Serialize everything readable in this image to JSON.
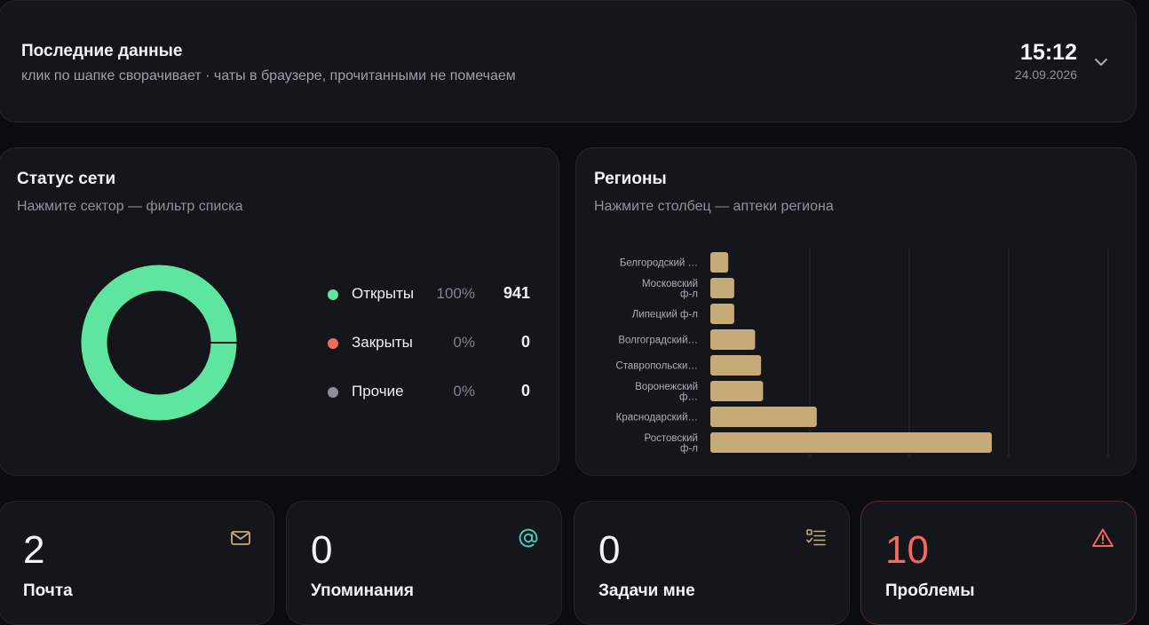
{
  "header": {
    "title": "Последние данные",
    "subtitle": "клик по шапке сворачивает · чаты в браузере, прочитанными не помечаем",
    "time": "15:12",
    "date": "24.09.2026"
  },
  "status": {
    "title": "Статус сети",
    "subtitle": "Нажмите сектор — фильтр списка",
    "items": [
      {
        "label": "Открыты",
        "percent": "100%",
        "count": "941",
        "color": "#5ee6a0"
      },
      {
        "label": "Закрыты",
        "percent": "0%",
        "count": "0",
        "color": "#f26a5b"
      },
      {
        "label": "Прочие",
        "percent": "0%",
        "count": "0",
        "color": "#8b8f99"
      }
    ]
  },
  "regions": {
    "title": "Регионы",
    "subtitle": "Нажмите столбец — аптеки региона"
  },
  "chart_data": {
    "type": "bar",
    "orientation": "horizontal",
    "categories": [
      [
        "Белгородский …"
      ],
      [
        "Московский",
        "ф-л"
      ],
      [
        "Липецкий ф-л"
      ],
      [
        "Волгоградский…"
      ],
      [
        "Ставропольски…"
      ],
      [
        "Воронежский",
        "ф…"
      ],
      [
        "Краснодарский…"
      ],
      [
        "Ростовский",
        "ф-л"
      ]
    ],
    "values": [
      18,
      24,
      24,
      45,
      51,
      53,
      107,
      283
    ],
    "xlim": [
      0,
      400
    ],
    "grid": true,
    "bar_color": "#c6ab78"
  },
  "stats": [
    {
      "value": "2",
      "label": "Почта",
      "icon": "mail-icon",
      "color": "#c6ab78"
    },
    {
      "value": "0",
      "label": "Упоминания",
      "icon": "at-icon",
      "color": "#4cc3b8"
    },
    {
      "value": "0",
      "label": "Задачи мне",
      "icon": "checklist-icon",
      "color": "#c6ab78"
    },
    {
      "value": "10",
      "label": "Проблемы",
      "icon": "warning-icon",
      "color": "#f26a5b"
    }
  ]
}
